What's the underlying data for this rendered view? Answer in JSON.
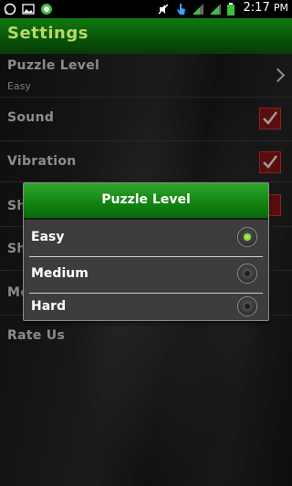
{
  "status_bar": {
    "time": "2:17",
    "ampm": "PM",
    "icons": [
      "whatsapp-icon",
      "image-icon",
      "app-icon",
      "mute-icon",
      "signal-bars-icon",
      "signal-bars-icon",
      "battery-icon"
    ]
  },
  "app": {
    "title": "Settings"
  },
  "settings": {
    "puzzle_level": {
      "label": "Puzzle Level",
      "value": "Easy"
    },
    "sound": {
      "label": "Sound",
      "checked": true
    },
    "vibration": {
      "label": "Vibration",
      "checked": true
    },
    "row4_partial": "Sh",
    "row5_partial": "Sh",
    "row6_partial": "Mo",
    "rate_us": {
      "label": "Rate Us"
    }
  },
  "dialog": {
    "title": "Puzzle Level",
    "options": [
      {
        "label": "Easy",
        "selected": true
      },
      {
        "label": "Medium",
        "selected": false
      },
      {
        "label": "Hard",
        "selected": false
      }
    ]
  },
  "colors": {
    "accent_green": "#128412",
    "checkbox_red": "#8a1414",
    "title_text": "#b8d86a"
  }
}
